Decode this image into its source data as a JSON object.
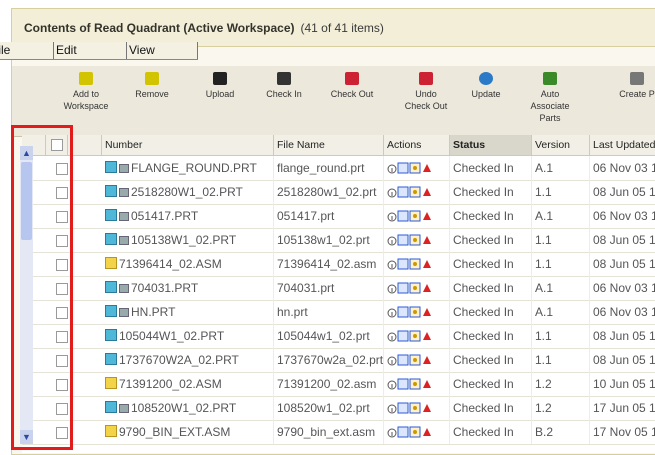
{
  "title": {
    "bold": "Contents of Read Quadrant (Active Workspace)",
    "count": "(41 of 41 items)"
  },
  "menu": [
    "File",
    "Edit",
    "View"
  ],
  "toolbar": [
    {
      "label": "Add to\nWorkspace",
      "icon": "add-icon"
    },
    {
      "label": "Remove",
      "icon": "remove-icon"
    },
    {
      "label": "Upload",
      "icon": "upload-icon"
    },
    {
      "label": "Check In",
      "icon": "check-in-icon"
    },
    {
      "label": "Check Out",
      "icon": "check-out-icon"
    },
    {
      "label": "Undo\nCheck Out",
      "icon": "undo-check-out-icon"
    },
    {
      "label": "Update",
      "icon": "update-icon"
    },
    {
      "label": "Auto\nAssociate\nParts",
      "icon": "auto-associate-icon"
    },
    {
      "label": "Create P",
      "icon": "create-icon"
    }
  ],
  "columns": [
    "Number",
    "File Name",
    "Actions",
    "Status",
    "Version",
    "Last Updated"
  ],
  "rows": [
    {
      "number": "FLANGE_ROUND.PRT",
      "file": "flange_round.prt",
      "status": "Checked In",
      "version": "A.1",
      "updated": "06 Nov 03 1",
      "type": "prt",
      "extra": true
    },
    {
      "number": "2518280W1_02.PRT",
      "file": "2518280w1_02.prt",
      "status": "Checked In",
      "version": "1.1",
      "updated": "08 Jun 05 1",
      "type": "prt",
      "extra": true
    },
    {
      "number": "051417.PRT",
      "file": "051417.prt",
      "status": "Checked In",
      "version": "A.1",
      "updated": "06 Nov 03 1",
      "type": "prt",
      "extra": true
    },
    {
      "number": "105138W1_02.PRT",
      "file": "105138w1_02.prt",
      "status": "Checked In",
      "version": "1.1",
      "updated": "08 Jun 05 1",
      "type": "prt",
      "extra": true
    },
    {
      "number": "71396414_02.ASM",
      "file": "71396414_02.asm",
      "status": "Checked In",
      "version": "1.1",
      "updated": "08 Jun 05 1",
      "type": "asm",
      "extra": false
    },
    {
      "number": "704031.PRT",
      "file": "704031.prt",
      "status": "Checked In",
      "version": "A.1",
      "updated": "06 Nov 03 1",
      "type": "prt",
      "extra": true
    },
    {
      "number": "HN.PRT",
      "file": "hn.prt",
      "status": "Checked In",
      "version": "A.1",
      "updated": "06 Nov 03 1",
      "type": "prt",
      "extra": true
    },
    {
      "number": "105044W1_02.PRT",
      "file": "105044w1_02.prt",
      "status": "Checked In",
      "version": "1.1",
      "updated": "08 Jun 05 1",
      "type": "prt",
      "extra": false
    },
    {
      "number": "1737670W2A_02.PRT",
      "file": "1737670w2a_02.prt",
      "status": "Checked In",
      "version": "1.1",
      "updated": "08 Jun 05 1",
      "type": "prt",
      "extra": false
    },
    {
      "number": "71391200_02.ASM",
      "file": "71391200_02.asm",
      "status": "Checked In",
      "version": "1.2",
      "updated": "10 Jun 05 1",
      "type": "asm",
      "extra": false
    },
    {
      "number": "108520W1_02.PRT",
      "file": "108520w1_02.prt",
      "status": "Checked In",
      "version": "1.2",
      "updated": "17 Jun 05 1",
      "type": "prt",
      "extra": true
    },
    {
      "number": "9790_BIN_EXT.ASM",
      "file": "9790_bin_ext.asm",
      "status": "Checked In",
      "version": "B.2",
      "updated": "17 Nov 05 1",
      "type": "asm",
      "extra": false
    }
  ]
}
